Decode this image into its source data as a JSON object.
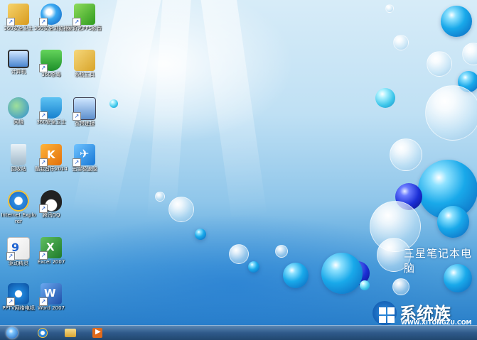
{
  "desktop": {
    "icons": [
      {
        "label": "360安全卫士",
        "icon": "folder-icon"
      },
      {
        "label": "360安全浏览器",
        "icon": "browser-icon"
      },
      {
        "label": "爱奇艺PPS影音",
        "icon": "video-icon"
      },
      {
        "label": "计算机",
        "icon": "computer-icon"
      },
      {
        "label": "360杀毒",
        "icon": "shield-icon"
      },
      {
        "label": "系统工具",
        "icon": "folder-icon"
      },
      {
        "label": "网络",
        "icon": "network-icon"
      },
      {
        "label": "360安全卫士",
        "icon": "shield-icon"
      },
      {
        "label": "宽带连接",
        "icon": "network-icon"
      },
      {
        "label": "回收站",
        "icon": "recycle-bin-icon"
      },
      {
        "label": "酷我音乐2014",
        "icon": "music-icon"
      },
      {
        "label": "迅雷极速版",
        "icon": "download-icon"
      },
      {
        "label": "Internet Explorer",
        "icon": "ie-icon"
      },
      {
        "label": "腾讯QQ",
        "icon": "qq-icon"
      },
      {
        "label": "驱动精灵",
        "icon": "app-icon"
      },
      {
        "label": "Excel 2007",
        "icon": "excel-icon"
      },
      {
        "label": "PPTV网络电视",
        "icon": "tv-icon"
      },
      {
        "label": "Word 2007",
        "icon": "word-icon"
      }
    ],
    "brand_text": "三星笔记本电脑"
  },
  "watermark": {
    "title": "系统族",
    "url": "WWW.XITONGZU.COM"
  },
  "taskbar": {
    "items": [
      "start-button",
      "ie-icon",
      "file-explorer-icon",
      "media-player-icon"
    ]
  },
  "colors": {
    "accent": "#1aa3e8",
    "taskbar": "#2f5a8a"
  }
}
